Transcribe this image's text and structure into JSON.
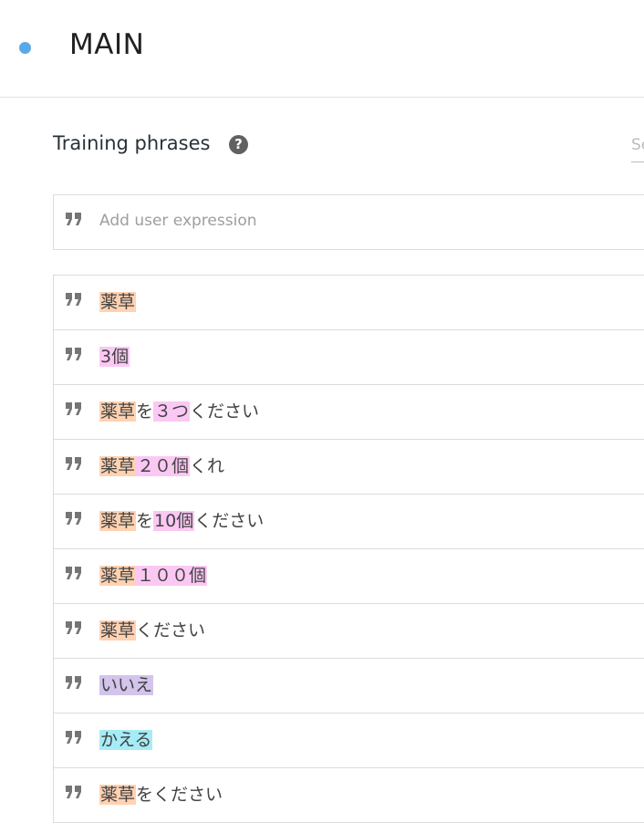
{
  "intent": {
    "title": "MAIN",
    "dot_color": "#5aa9e6"
  },
  "training": {
    "title": "Training phrases",
    "help_icon": "question-circle-icon",
    "search_placeholder": "Search",
    "add_placeholder": "Add user expression",
    "quote_icon": "quote-icon"
  },
  "entity_colors": {
    "orange": "#ffd2b2",
    "pink": "#fbc8f4",
    "purple": "#d2c4ea",
    "cyan": "#a6ecf6"
  },
  "phrases": [
    {
      "segments": [
        {
          "text": "薬草",
          "color": "orange"
        }
      ]
    },
    {
      "segments": [
        {
          "text": "3個",
          "color": "pink"
        }
      ]
    },
    {
      "segments": [
        {
          "text": "薬草",
          "color": "orange"
        },
        {
          "text": "を"
        },
        {
          "text": "３つ",
          "color": "pink"
        },
        {
          "text": "ください"
        }
      ]
    },
    {
      "segments": [
        {
          "text": "薬草",
          "color": "orange"
        },
        {
          "text": "２０個",
          "color": "pink"
        },
        {
          "text": "くれ"
        }
      ]
    },
    {
      "segments": [
        {
          "text": "薬草",
          "color": "orange"
        },
        {
          "text": "を"
        },
        {
          "text": "10個",
          "color": "pink"
        },
        {
          "text": "ください"
        }
      ]
    },
    {
      "segments": [
        {
          "text": "薬草",
          "color": "orange"
        },
        {
          "text": "１００個",
          "color": "pink"
        }
      ]
    },
    {
      "segments": [
        {
          "text": "薬草",
          "color": "orange"
        },
        {
          "text": "ください"
        }
      ]
    },
    {
      "segments": [
        {
          "text": "いいえ",
          "color": "purple"
        }
      ]
    },
    {
      "segments": [
        {
          "text": "かえる",
          "color": "cyan"
        }
      ]
    },
    {
      "segments": [
        {
          "text": "薬草",
          "color": "orange"
        },
        {
          "text": "をください"
        }
      ]
    }
  ]
}
